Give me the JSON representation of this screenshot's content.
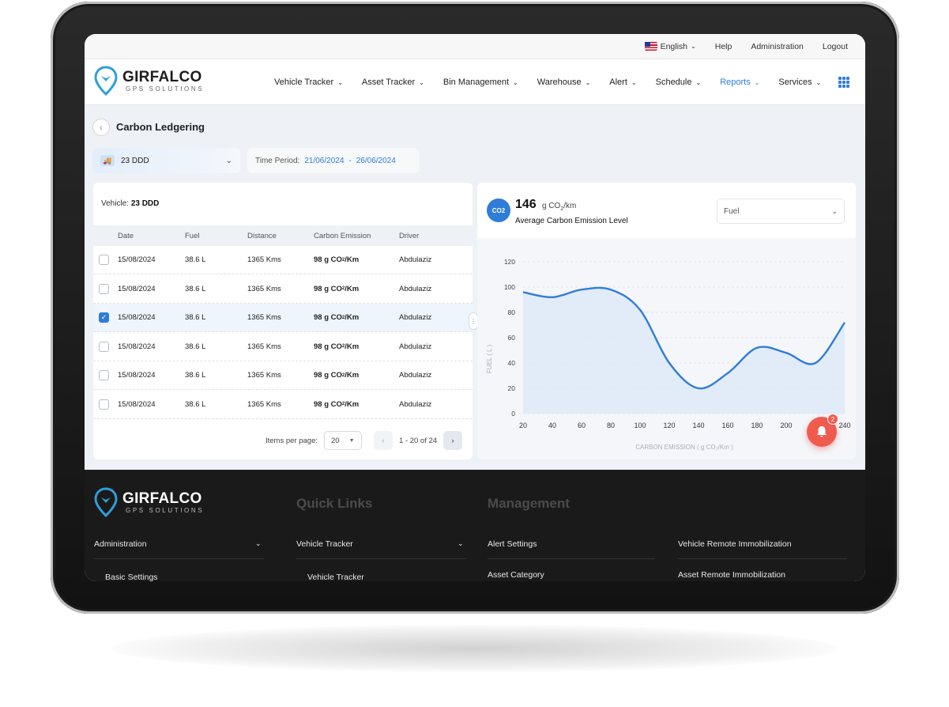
{
  "topbar": {
    "language": "English",
    "help": "Help",
    "administration": "Administration",
    "logout": "Logout"
  },
  "brand": {
    "name": "GIRFALCO",
    "tagline": "GPS SOLUTIONS"
  },
  "nav": {
    "items": [
      {
        "label": "Vehicle Tracker"
      },
      {
        "label": "Asset Tracker"
      },
      {
        "label": "Bin Management"
      },
      {
        "label": "Warehouse"
      },
      {
        "label": "Alert"
      },
      {
        "label": "Schedule"
      },
      {
        "label": "Reports",
        "active": true
      },
      {
        "label": "Services"
      }
    ],
    "accent": "#2f7dd8"
  },
  "page": {
    "title": "Carbon Ledgering",
    "vehicle_select": "23 DDD",
    "time_period_label": "Time Period:",
    "date_from": "21/06/2024",
    "date_sep": "-",
    "date_to": "26/06/2024"
  },
  "table": {
    "vehicle_label": "Vehicle:",
    "vehicle_value": "23 DDD",
    "columns": [
      "Date",
      "Fuel",
      "Distance",
      "Carbon Emission",
      "Driver"
    ],
    "rows": [
      {
        "date": "15/08/2024",
        "fuel": "38.6 L",
        "distance": "1365 Kms",
        "co2_prefix": "98 g CO",
        "co2_sub": "2",
        "co2_suffix": "/Km",
        "driver": "Abdulaziz",
        "checked": false
      },
      {
        "date": "15/08/2024",
        "fuel": "38.6 L",
        "distance": "1365 Kms",
        "co2_prefix": "98 g CO",
        "co2_sub": "2",
        "co2_suffix": "/Km",
        "driver": "Abdulaziz",
        "checked": false
      },
      {
        "date": "15/08/2024",
        "fuel": "38.6 L",
        "distance": "1365 Kms",
        "co2_prefix": "98 g CO",
        "co2_sub": "2",
        "co2_suffix": "/Km",
        "driver": "Abdulaziz",
        "checked": true
      },
      {
        "date": "15/08/2024",
        "fuel": "38.6 L",
        "distance": "1365 Kms",
        "co2_prefix": "98 g CO",
        "co2_sub": "2",
        "co2_suffix": "/Km",
        "driver": "Abdulaziz",
        "checked": false
      },
      {
        "date": "15/08/2024",
        "fuel": "38.6 L",
        "distance": "1365 Kms",
        "co2_prefix": "98 g CO",
        "co2_sub": "2",
        "co2_suffix": "/Km",
        "driver": "Abdulaziz",
        "checked": false
      },
      {
        "date": "15/08/2024",
        "fuel": "38.6 L",
        "distance": "1365 Kms",
        "co2_prefix": "98 g CO",
        "co2_sub": "2",
        "co2_suffix": "/Km",
        "driver": "Abdulaziz",
        "checked": false
      }
    ],
    "items_per_page_label": "Items per page:",
    "items_per_page": "20",
    "page_range": "1 - 20 of 24"
  },
  "emission": {
    "value": "146",
    "unit_prefix": "g CO",
    "unit_sub": "2",
    "unit_suffix": "/km",
    "label": "Average Carbon Emission Level",
    "metric_select": "Fuel",
    "icon_text": "CO2"
  },
  "chart_data": {
    "type": "area",
    "x": [
      20,
      40,
      60,
      80,
      100,
      120,
      140,
      160,
      180,
      200,
      220,
      240
    ],
    "values": [
      96,
      92,
      98,
      98,
      82,
      40,
      20,
      32,
      52,
      48,
      40,
      72
    ],
    "xlim": [
      20,
      240
    ],
    "ylim": [
      0,
      120
    ],
    "yticks": [
      0,
      20,
      40,
      60,
      80,
      100,
      120
    ],
    "xticks": [
      20,
      40,
      60,
      80,
      100,
      120,
      140,
      160,
      180,
      200,
      220,
      240
    ],
    "ylabel": "FUEL ( L )",
    "xlabel": "CARBON EMISSION ( g CO₂/Km )",
    "line_color": "#2f7dd8",
    "grid": true
  },
  "notification": {
    "count": "2"
  },
  "footer": {
    "quick_links_heading": "Quick Links",
    "management_heading": "Management",
    "col1": [
      "Administration",
      "Basic Settings"
    ],
    "col2": [
      "Vehicle Tracker",
      "Vehicle Tracker"
    ],
    "col3": [
      "Alert Settings",
      "Asset Category"
    ],
    "col4": [
      "Vehicle Remote Immobilization",
      "Asset Remote Immobilization"
    ]
  }
}
